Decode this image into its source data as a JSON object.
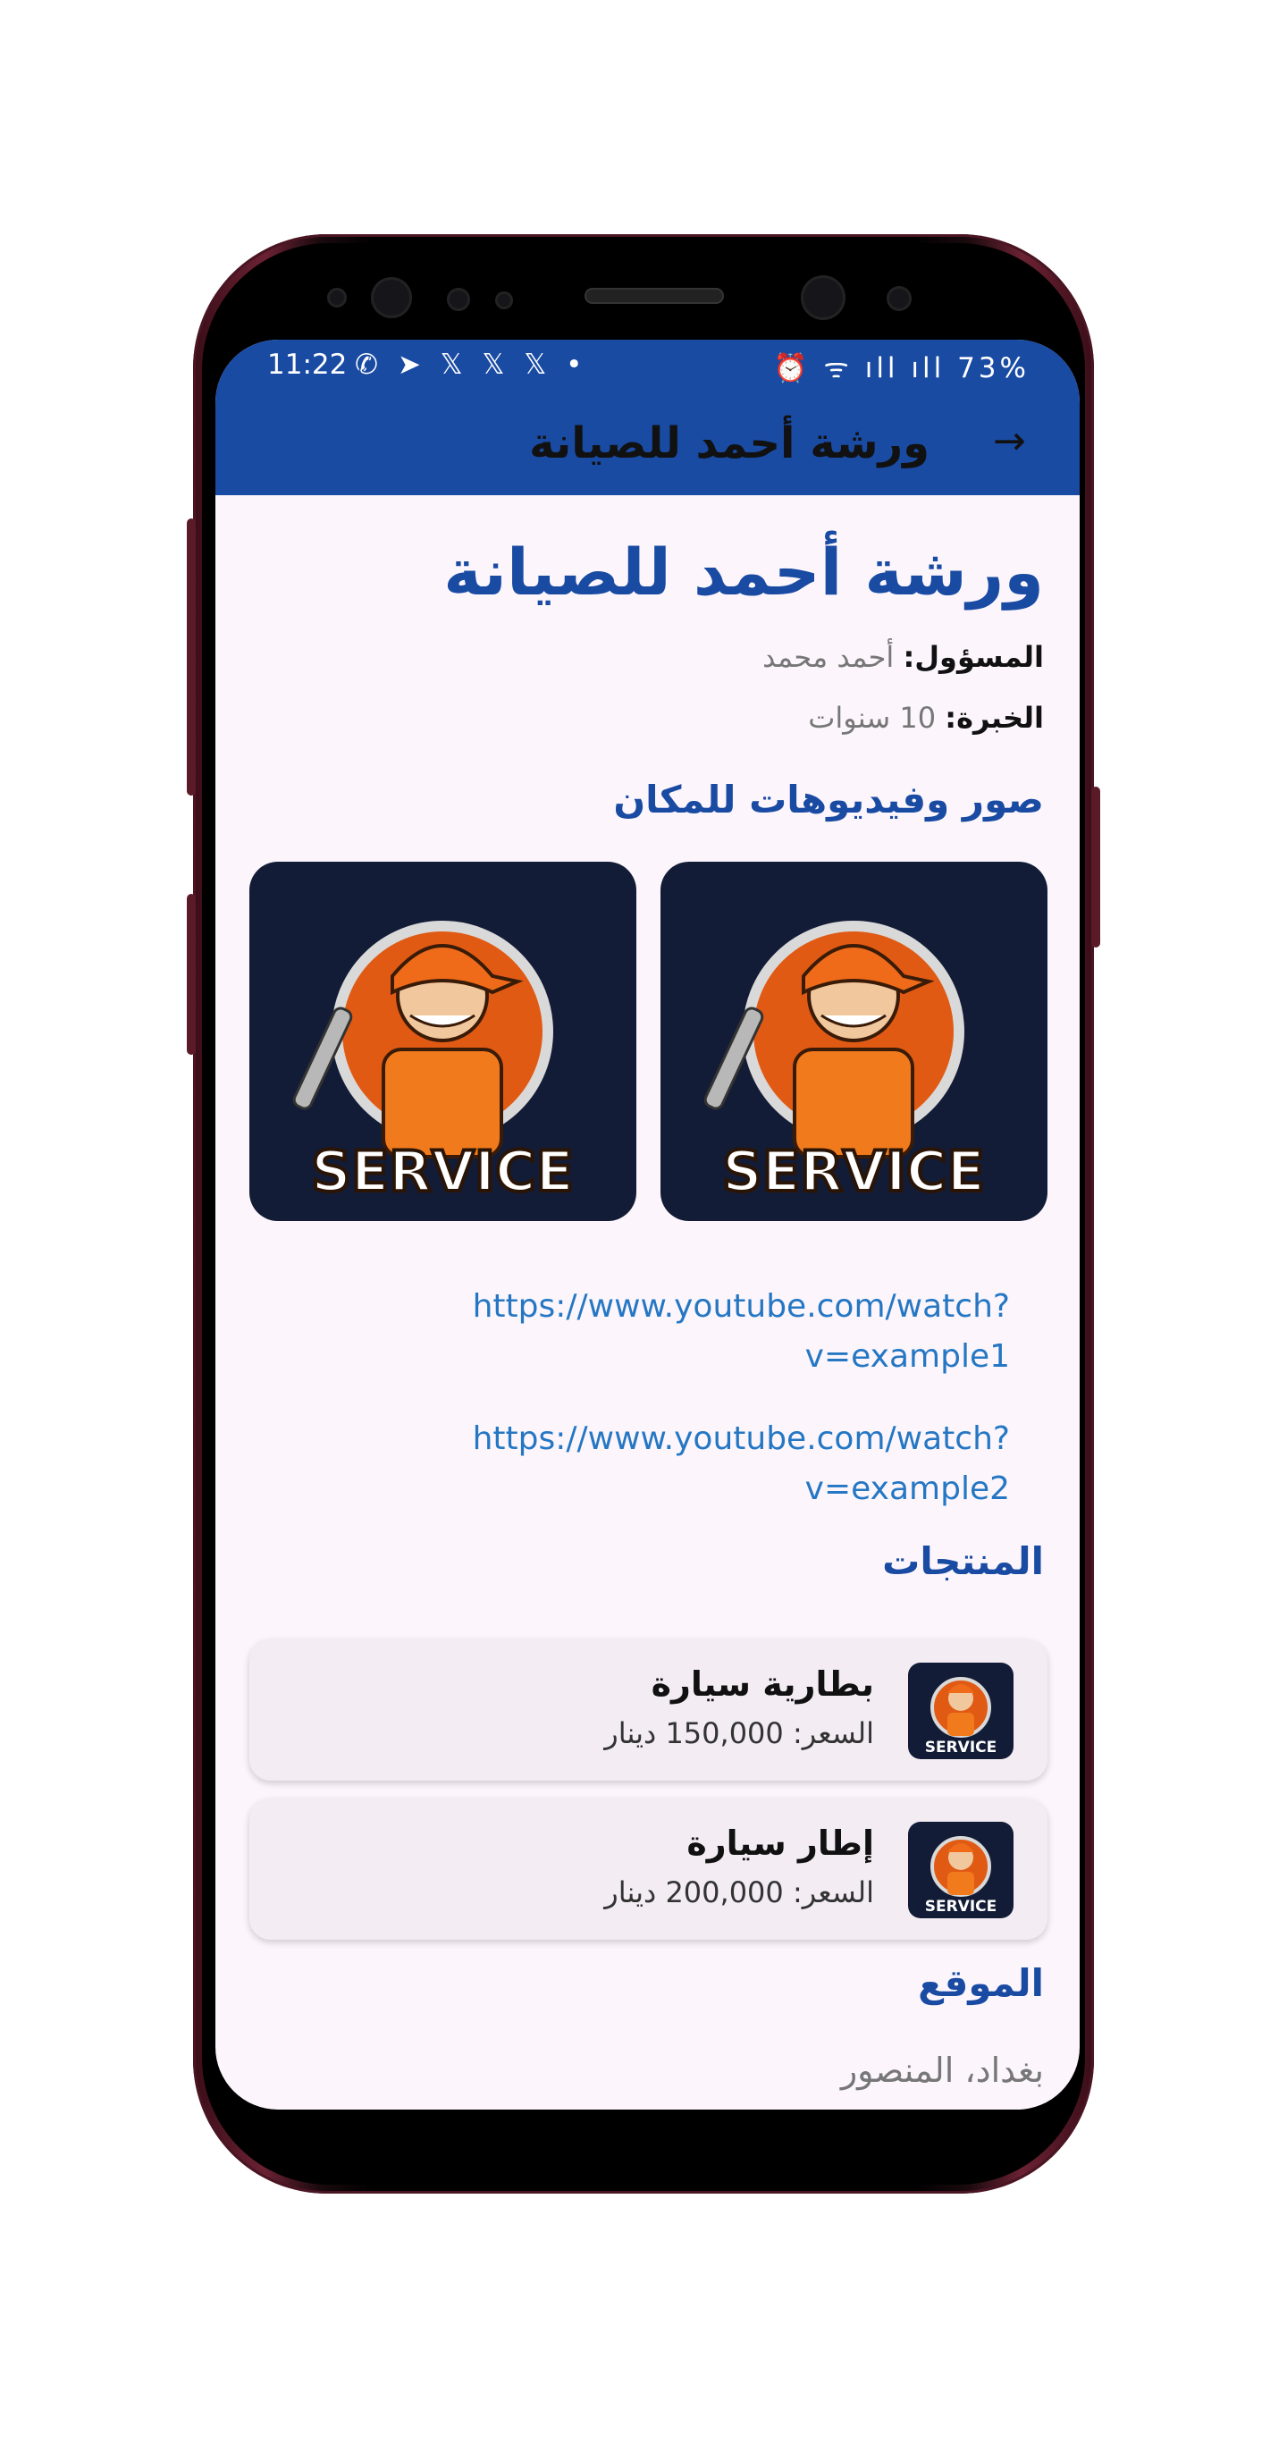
{
  "status_bar": {
    "time": "11:22",
    "left_icons": "✆ ➤ 𝕏 𝕏 𝕏 •",
    "right_icons": "⏰ ᯤ ıll ıll 73%",
    "battery": "73%"
  },
  "app_bar": {
    "title": "ورشة أحمد للصيانة",
    "back_icon": "→"
  },
  "shop": {
    "name": "ورشة أحمد للصيانة",
    "manager_label": "المسؤول:",
    "manager_value": "أحمد محمد",
    "experience_label": "الخبرة:",
    "experience_value": "10 سنوات"
  },
  "media": {
    "heading": "صور وفيديوهات للمكان",
    "image_text": "SERVICE",
    "links": [
      {
        "line1": "https://www.youtube.com/watch?",
        "line2": "v=example1"
      },
      {
        "line1": "https://www.youtube.com/watch?",
        "line2": "v=example2"
      }
    ]
  },
  "products": {
    "heading": "المنتجات",
    "items": [
      {
        "name": "بطارية سيارة",
        "price": "السعر: 150,000 دينار"
      },
      {
        "name": "إطار سيارة",
        "price": "السعر: 200,000 دينار"
      }
    ]
  },
  "location": {
    "heading": "الموقع",
    "value": "بغداد، المنصور"
  },
  "colors": {
    "primary": "#1a4ba3",
    "link": "#2577c4",
    "background": "#fcf6fc"
  }
}
